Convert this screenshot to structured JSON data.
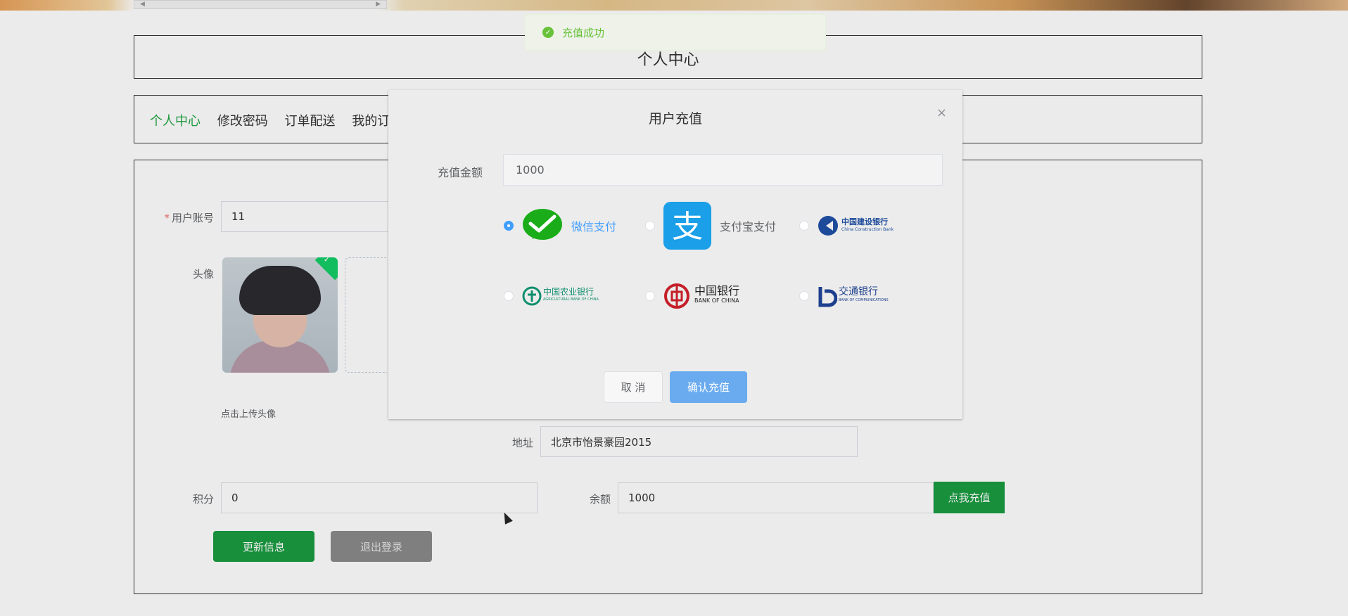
{
  "page": {
    "title": "个人中心",
    "nav": [
      "个人中心",
      "修改密码",
      "订单配送",
      "我的订"
    ],
    "form": {
      "account_label": "用户账号",
      "account_required": "*",
      "account_value": "11",
      "avatar_label": "头像",
      "avatar_hint": "点击上传头像",
      "address_label": "地址",
      "address_value": "北京市怡景豪园2015",
      "points_label": "积分",
      "points_value": "0",
      "balance_label": "余额",
      "balance_value": "1000",
      "recharge_button": "点我充值",
      "update_button": "更新信息",
      "logout_button": "退出登录"
    }
  },
  "toast": {
    "message": "充值成功",
    "icon": "check-circle-icon",
    "color": "#67c23a"
  },
  "modal": {
    "title": "用户充值",
    "close": "×",
    "amount_label": "充值金额",
    "amount_value": "1000",
    "payments": [
      {
        "label": "微信支付",
        "logo": "wechat-pay-logo",
        "selected": true
      },
      {
        "label": "支付宝支付",
        "logo": "alipay-logo",
        "selected": false
      },
      {
        "label": "中国建设银行",
        "sub": "China Construction Bank",
        "logo": "ccb-logo",
        "selected": false
      },
      {
        "label": "中国农业银行",
        "sub": "AGRICULTURAL BANK OF CHINA",
        "logo": "abc-logo",
        "selected": false
      },
      {
        "label": "中国银行",
        "sub": "BANK OF CHINA",
        "logo": "boc-logo",
        "selected": false
      },
      {
        "label": "交通银行",
        "sub": "BANK OF COMMUNICATIONS",
        "logo": "bocom-logo",
        "selected": false
      }
    ],
    "cancel_button": "取 消",
    "confirm_button": "确认充值"
  },
  "colors": {
    "primary_green": "#1a9c41",
    "active_nav": "#22a545",
    "accent_blue": "#409eff"
  }
}
